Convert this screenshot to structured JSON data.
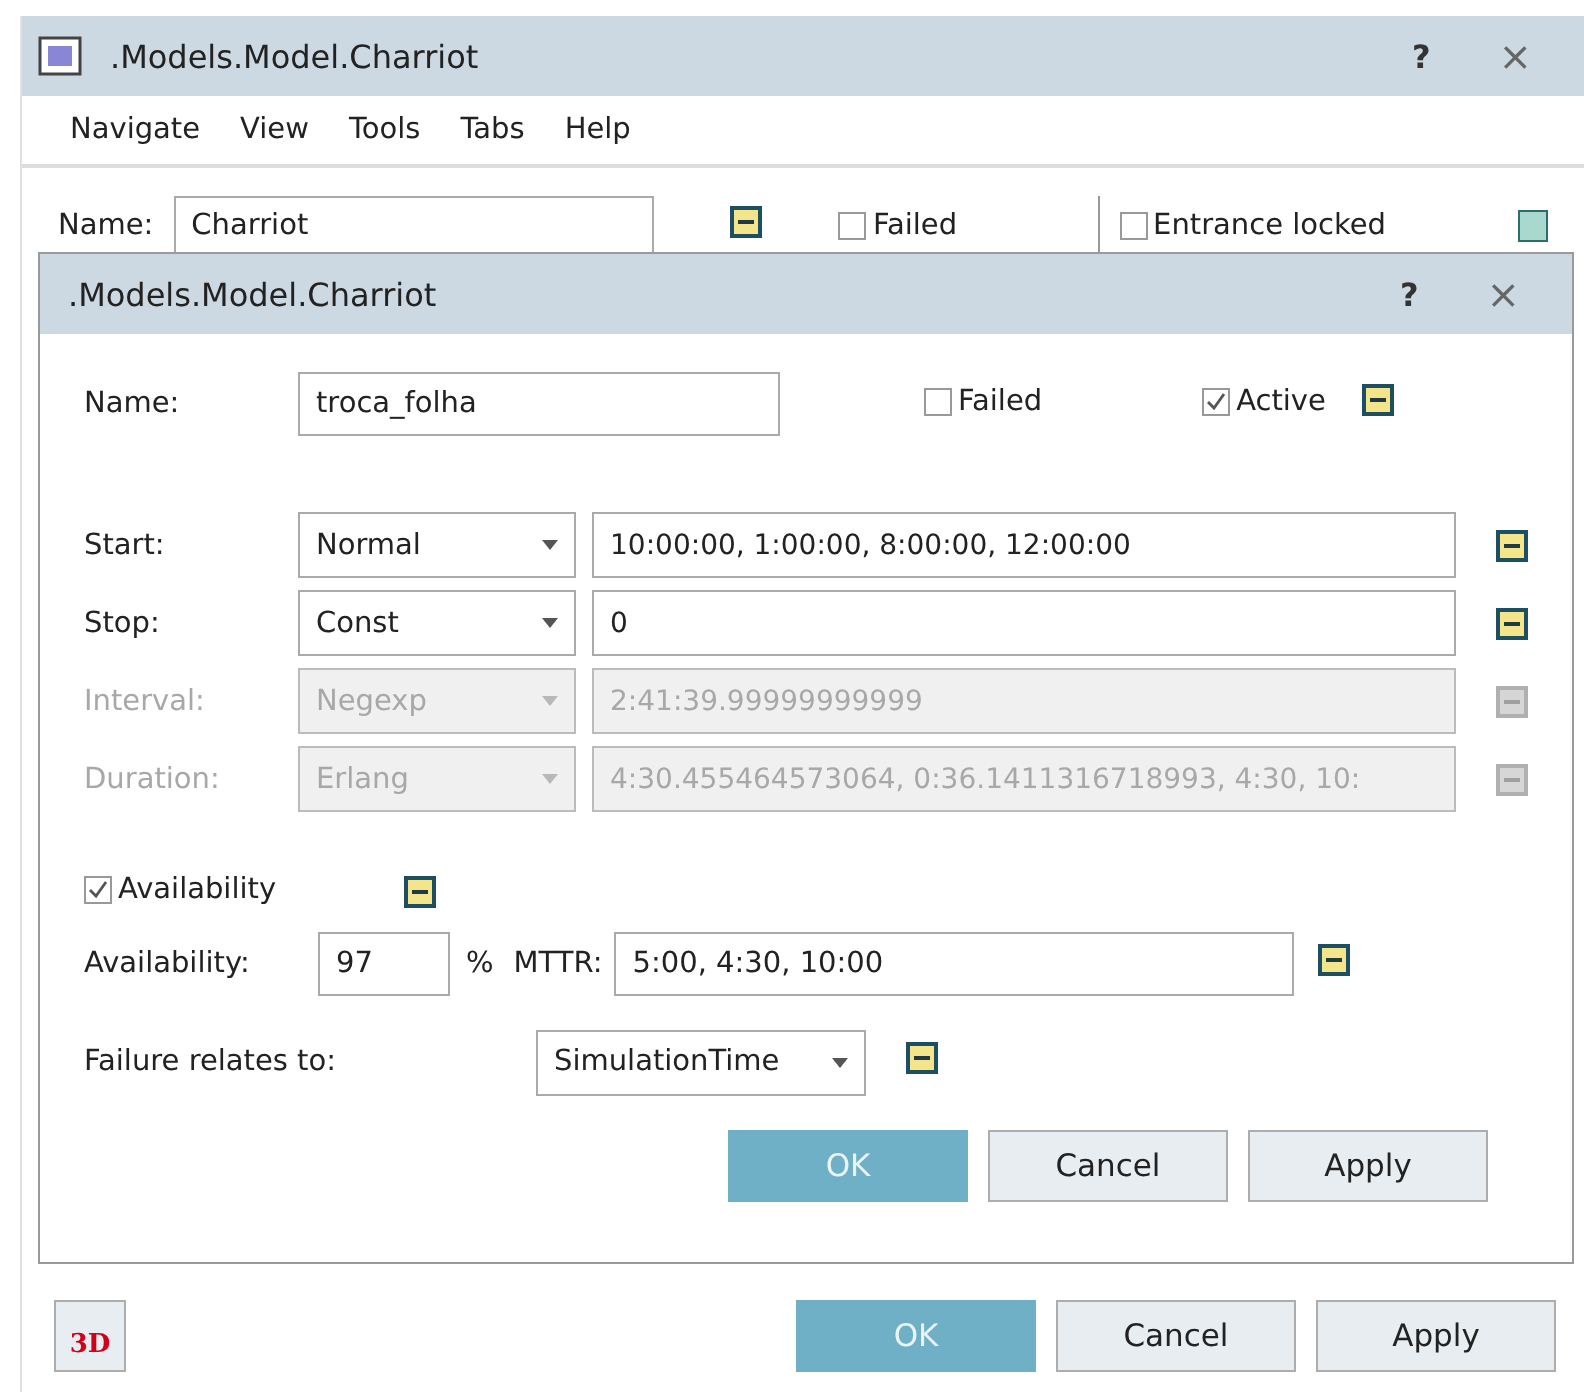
{
  "window": {
    "title": ".Models.Model.Charriot",
    "help": "?",
    "close": "×"
  },
  "menu": [
    "Navigate",
    "View",
    "Tools",
    "Tabs",
    "Help"
  ],
  "background_form": {
    "name_label": "Name:",
    "name_value": "Charriot",
    "failed": {
      "label": "Failed",
      "checked": false
    },
    "entrance_locked": {
      "label": "Entrance locked",
      "checked": false
    }
  },
  "dialog": {
    "title": ".Models.Model.Charriot",
    "help": "?",
    "close": "×",
    "name": {
      "label": "Name:",
      "value": "troca_folha"
    },
    "failed": {
      "label": "Failed",
      "checked": false
    },
    "active": {
      "label": "Active",
      "checked": true
    },
    "rows": [
      {
        "label": "Start:",
        "distribution": "Normal",
        "value": "10:00:00, 1:00:00, 8:00:00, 12:00:00",
        "disabled": false
      },
      {
        "label": "Stop:",
        "distribution": "Const",
        "value": "0",
        "disabled": false
      },
      {
        "label": "Interval:",
        "distribution": "Negexp",
        "value": "2:41:39.99999999999",
        "disabled": true
      },
      {
        "label": "Duration:",
        "distribution": "Erlang",
        "value": "4:30.455464573064, 0:36.1411316718993, 4:30, 10:",
        "disabled": true
      }
    ],
    "availability_toggle": {
      "label": "Availability",
      "checked": true
    },
    "availability": {
      "label": "Availability:",
      "value": "97",
      "unit": "%"
    },
    "mttr": {
      "label": "MTTR:",
      "value": "5:00, 4:30, 10:00"
    },
    "failure_relates": {
      "label": "Failure relates to:",
      "value": "SimulationTime"
    },
    "buttons": [
      {
        "label": "OK",
        "default": true
      },
      {
        "label": "Cancel",
        "default": false
      },
      {
        "label": "Apply",
        "default": false
      }
    ]
  },
  "footer": {
    "logo": "3D",
    "buttons": [
      {
        "label": "OK",
        "default": true
      },
      {
        "label": "Cancel",
        "default": false
      },
      {
        "label": "Apply",
        "default": false
      }
    ]
  }
}
